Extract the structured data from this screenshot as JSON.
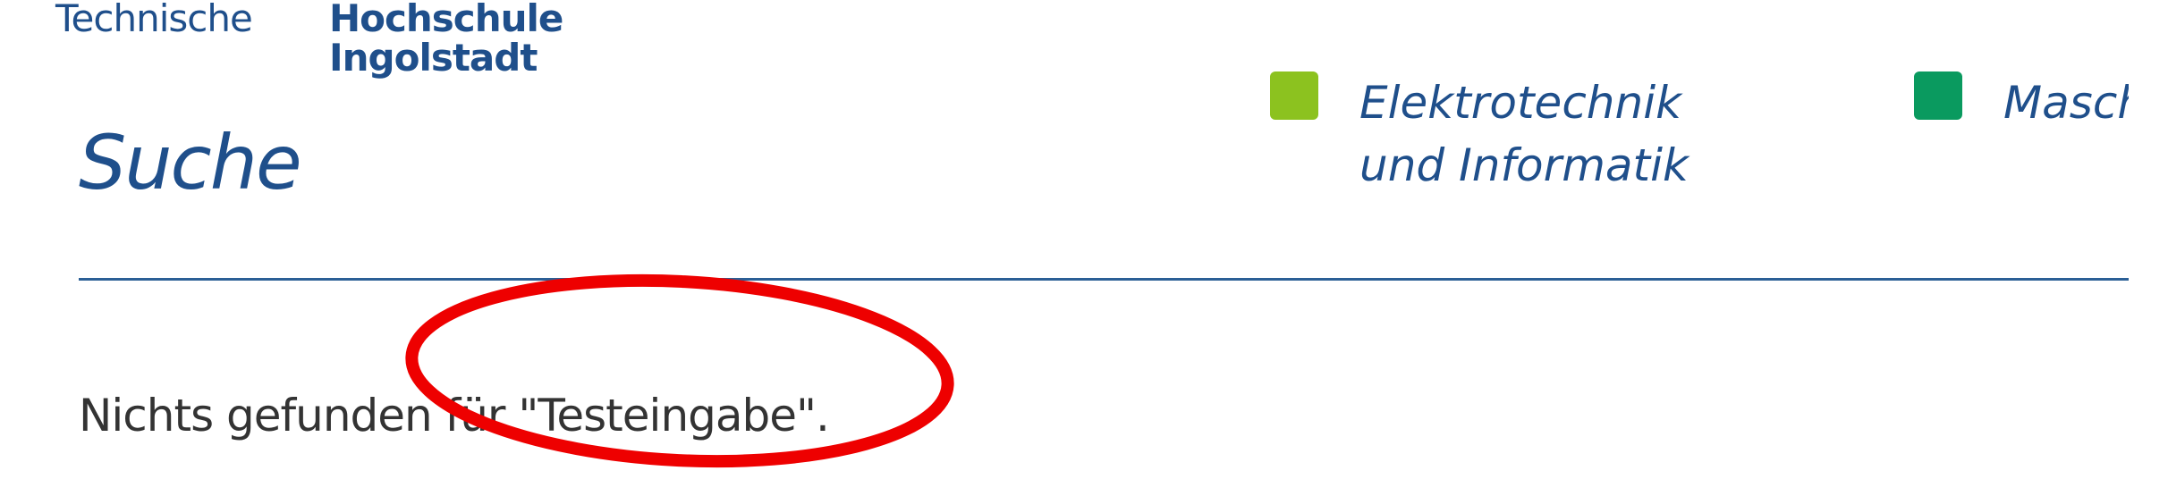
{
  "logo": {
    "line1_regular": "Technische",
    "line1_bold": "Hochschule",
    "line2_bold": "Ingolstadt"
  },
  "page": {
    "title": "Suche"
  },
  "faculties": [
    {
      "label": "Elektrotechnik und Informatik",
      "color": "#8cc21f"
    },
    {
      "label": "Maschinenbau",
      "color": "#0a9a5f"
    }
  ],
  "search": {
    "result_message": "Nichts gefunden für \"Testeingabe\"."
  },
  "colors": {
    "brand_blue": "#1f4f8b",
    "annotation_red": "#ee0000"
  }
}
